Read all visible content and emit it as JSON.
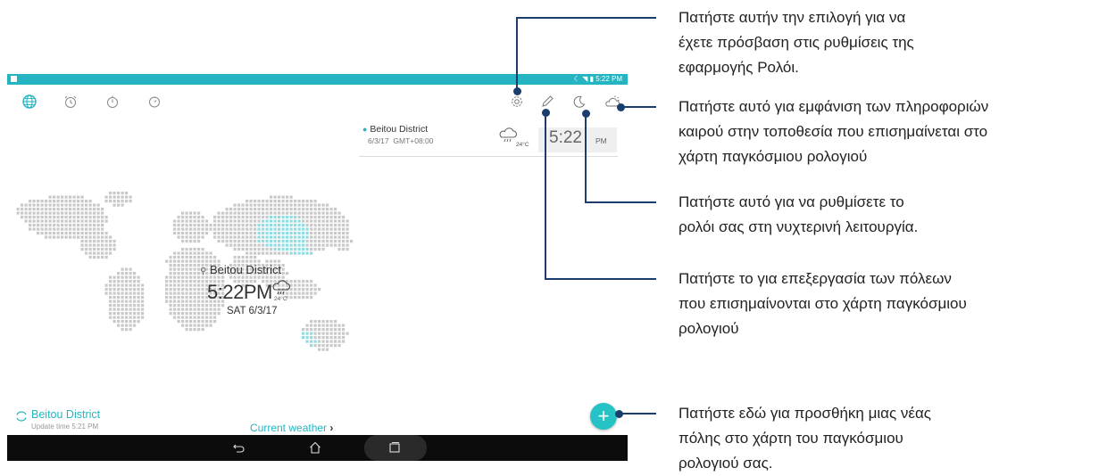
{
  "status_bar": {
    "time": "5:22 PM"
  },
  "tabs": [
    {
      "icon": "globe-icon"
    },
    {
      "icon": "alarm-icon"
    },
    {
      "icon": "stopwatch-icon"
    },
    {
      "icon": "timer-icon"
    }
  ],
  "actions": [
    {
      "icon": "gear-icon"
    },
    {
      "icon": "pencil-icon"
    },
    {
      "icon": "moon-icon"
    },
    {
      "icon": "weather-icon"
    }
  ],
  "city_card": {
    "city": "Beitou District",
    "date": "6/3/17",
    "gmt": "GMT+08:00",
    "temp": "24°C",
    "time": "5:22",
    "ampm": "PM"
  },
  "map_clock": {
    "city": "Beitou District",
    "time": "5:22PM",
    "temp": "24°C",
    "date": "SAT 6/3/17"
  },
  "footer": {
    "city": "Beitou District",
    "update_time": "Update time 5:21 PM",
    "weather_link": "Current weather"
  },
  "fab": {
    "label": "+"
  },
  "navbar": {
    "icons": [
      "back-icon",
      "home-icon",
      "recent-apps-icon"
    ]
  },
  "callouts": {
    "settings": "Πατήστε αυτήν την επιλογή για να\nέχετε πρόσβαση στις ρυθμίσεις της\nεφαρμογής Ρολόι.",
    "weather": "Πατήστε αυτό για εμφάνιση των πληροφοριών\nκαιρού στην τοποθεσία που επισημαίνεται στο\nχάρτη παγκόσμιου ρολογιού",
    "night": "Πατήστε αυτό για να ρυθμίσετε το\nρολόι σας στη νυχτερινή λειτουργία.",
    "edit": "Πατήστε το για επεξεργασία των πόλεων\nπου επισημαίνονται στο χάρτη παγκόσμιου\nρολογιού",
    "add": "Πατήστε εδώ για προσθήκη μιας νέας\nπόλης στο χάρτη του παγκόσμιου\nρολογιού σας."
  },
  "colors": {
    "accent": "#25b5c2",
    "callout_line": "#1a3d6e",
    "map_dot": "#c9c9c9",
    "map_highlight": "#8fdde0"
  }
}
